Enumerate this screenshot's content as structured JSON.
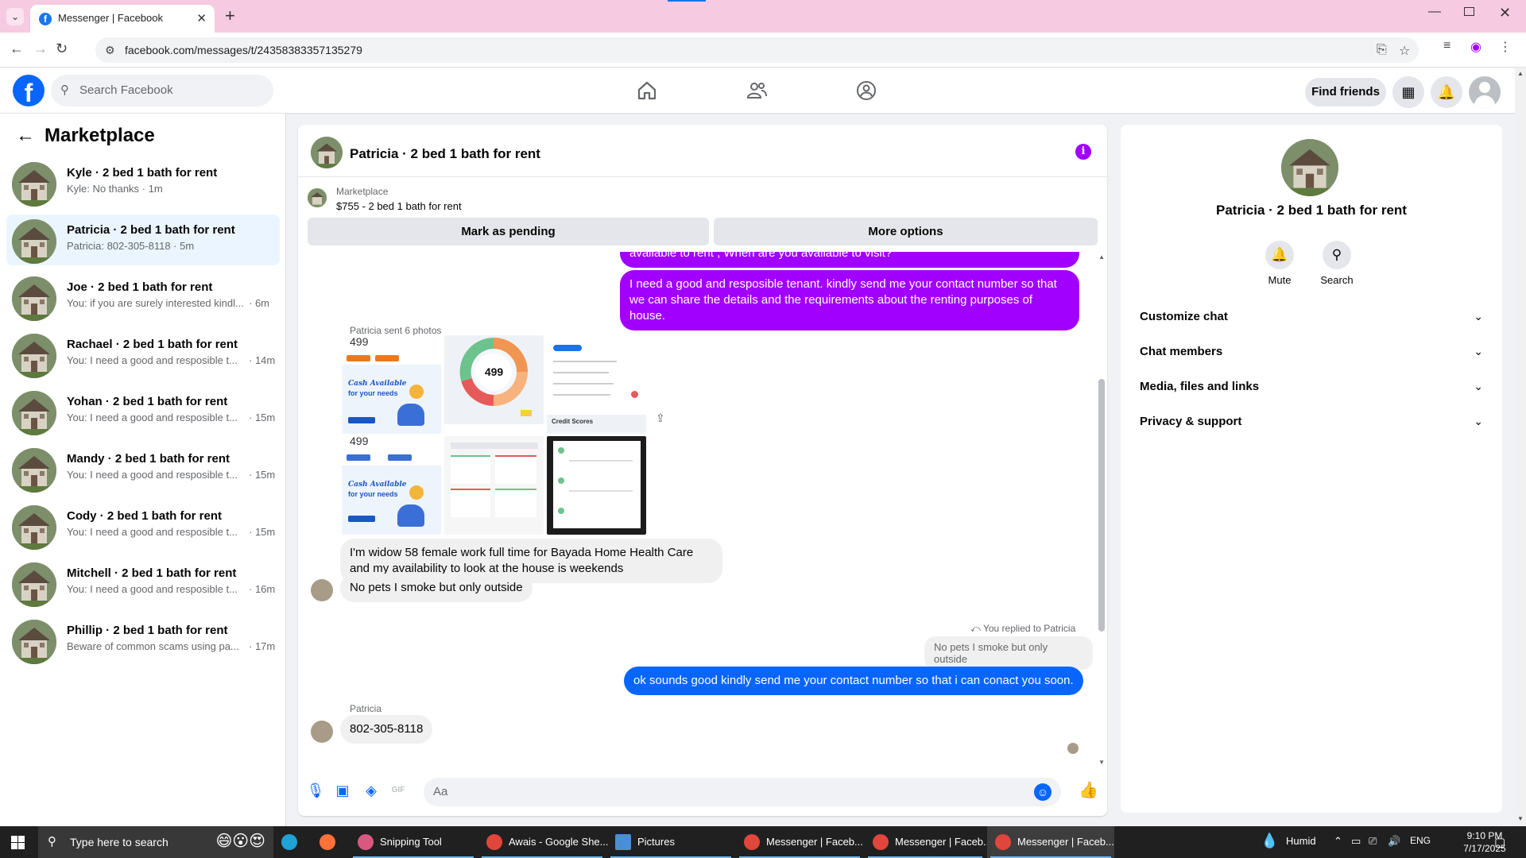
{
  "browser": {
    "tab_title": "Messenger | Facebook",
    "url": "facebook.com/messages/t/24358383357135279",
    "new_tab": "+",
    "close": "✕"
  },
  "fb": {
    "logo": "f",
    "search_placeholder": "Search Facebook",
    "find_friends": "Find friends"
  },
  "sidebar": {
    "title": "Marketplace",
    "conversations": [
      {
        "name": "Kyle · 2 bed 1 bath for rent",
        "preview": "Kyle: No thanks · 1m",
        "time": ""
      },
      {
        "name": "Patricia · 2 bed 1 bath for rent",
        "preview": "Patricia: 802-305-8118 · 5m",
        "time": ""
      },
      {
        "name": "Joe · 2 bed 1 bath for rent",
        "preview": "You: if you are surely interested kindl...",
        "time": "· 6m"
      },
      {
        "name": "Rachael · 2 bed 1 bath for rent",
        "preview": "You: I need a good and resposible t...",
        "time": "· 14m"
      },
      {
        "name": "Yohan · 2 bed 1 bath for rent",
        "preview": "You: I need a good and resposible t...",
        "time": "· 15m"
      },
      {
        "name": "Mandy · 2 bed 1 bath for rent",
        "preview": "You: I need a good and resposible t...",
        "time": "· 15m"
      },
      {
        "name": "Cody · 2 bed 1 bath for rent",
        "preview": "You: I need a good and resposible t...",
        "time": "· 15m"
      },
      {
        "name": "Mitchell · 2 bed 1 bath for rent",
        "preview": "You: I need a good and resposible t...",
        "time": "· 16m"
      },
      {
        "name": "Phillip · 2 bed 1 bath for rent",
        "preview": "Beware of common scams using pa...",
        "time": "· 17m"
      }
    ]
  },
  "chat": {
    "title": "Patricia · 2 bed 1 bath for rent",
    "info": "i",
    "listing_category": "Marketplace",
    "listing_title": "$755 - 2 bed 1 bath for rent",
    "mark_pending": "Mark as pending",
    "more_options": "More options",
    "messages": {
      "out_cut": "available to rent , When are you available to visit?",
      "out_1": "I need a good and resposible tenant.  kindly send me your contact number so that we can share the details and the requirements about the renting purposes of house.",
      "photos_label": "Patricia sent 6 photos",
      "in_1": "I'm widow 58 female work full time for Bayada Home Health Care and my availability to look at the house is weekends",
      "in_2": "No pets I smoke but only outside",
      "replied_to": "You replied to Patricia",
      "quoted": "No pets I smoke but only outside",
      "out_2": "ok sounds good kindly  send me your contact number so that i can conact you soon.",
      "sender_label": "Patricia",
      "in_3": "802-305-8118"
    },
    "photo_text": {
      "price": "499",
      "cash": "Cash Available",
      "needs": "for your needs",
      "credit_scores": "Credit Scores"
    },
    "composer_placeholder": "Aa"
  },
  "info_panel": {
    "name": "Patricia · 2 bed 1 bath for rent",
    "mute": "Mute",
    "search": "Search",
    "sections": [
      "Customize chat",
      "Chat members",
      "Media, files and links",
      "Privacy & support"
    ]
  },
  "taskbar": {
    "search_placeholder": "Type here to search",
    "apps": [
      {
        "label": "Snipping Tool"
      },
      {
        "label": "Awais - Google She..."
      },
      {
        "label": "Pictures"
      },
      {
        "label": "Messenger | Faceb..."
      },
      {
        "label": "Messenger | Faceb..."
      },
      {
        "label": "Messenger | Faceb..."
      }
    ],
    "weather": "Humid",
    "lang": "ENG",
    "time": "9:10 PM",
    "date": "7/17/2025"
  },
  "colors": {
    "brand_blue": "#0866ff",
    "outgoing_bubble": "#a100ff",
    "active_conversation": "#ebf5ff"
  }
}
